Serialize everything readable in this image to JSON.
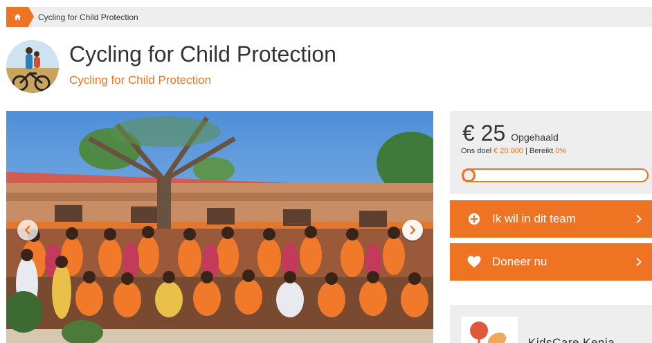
{
  "breadcrumb": {
    "home_icon": "home-icon",
    "current": "Cycling for Child Protection"
  },
  "header": {
    "title": "Cycling for Child Protection",
    "subtitle": "Cycling for Child Protection",
    "avatar_icon": "team-avatar"
  },
  "slider": {
    "prev_icon": "chevron-left-icon",
    "next_icon": "chevron-right-icon"
  },
  "donation": {
    "amount": "€ 25",
    "amount_label": "Opgehaald",
    "goal_prefix": "Ons doel ",
    "goal_value": "€ 20.000",
    "goal_sep": " | Bereikt ",
    "reached_value": "0%",
    "progress_fraction": 0.00125
  },
  "actions": {
    "join_label": "Ik wil in dit team",
    "join_icon": "plus-circle-icon",
    "donate_label": "Doneer nu",
    "donate_icon": "heart-icon"
  },
  "organization": {
    "name": "KidsCare Kenia"
  },
  "colors": {
    "accent": "#ee7322",
    "panel_bg": "#eeeeee"
  }
}
